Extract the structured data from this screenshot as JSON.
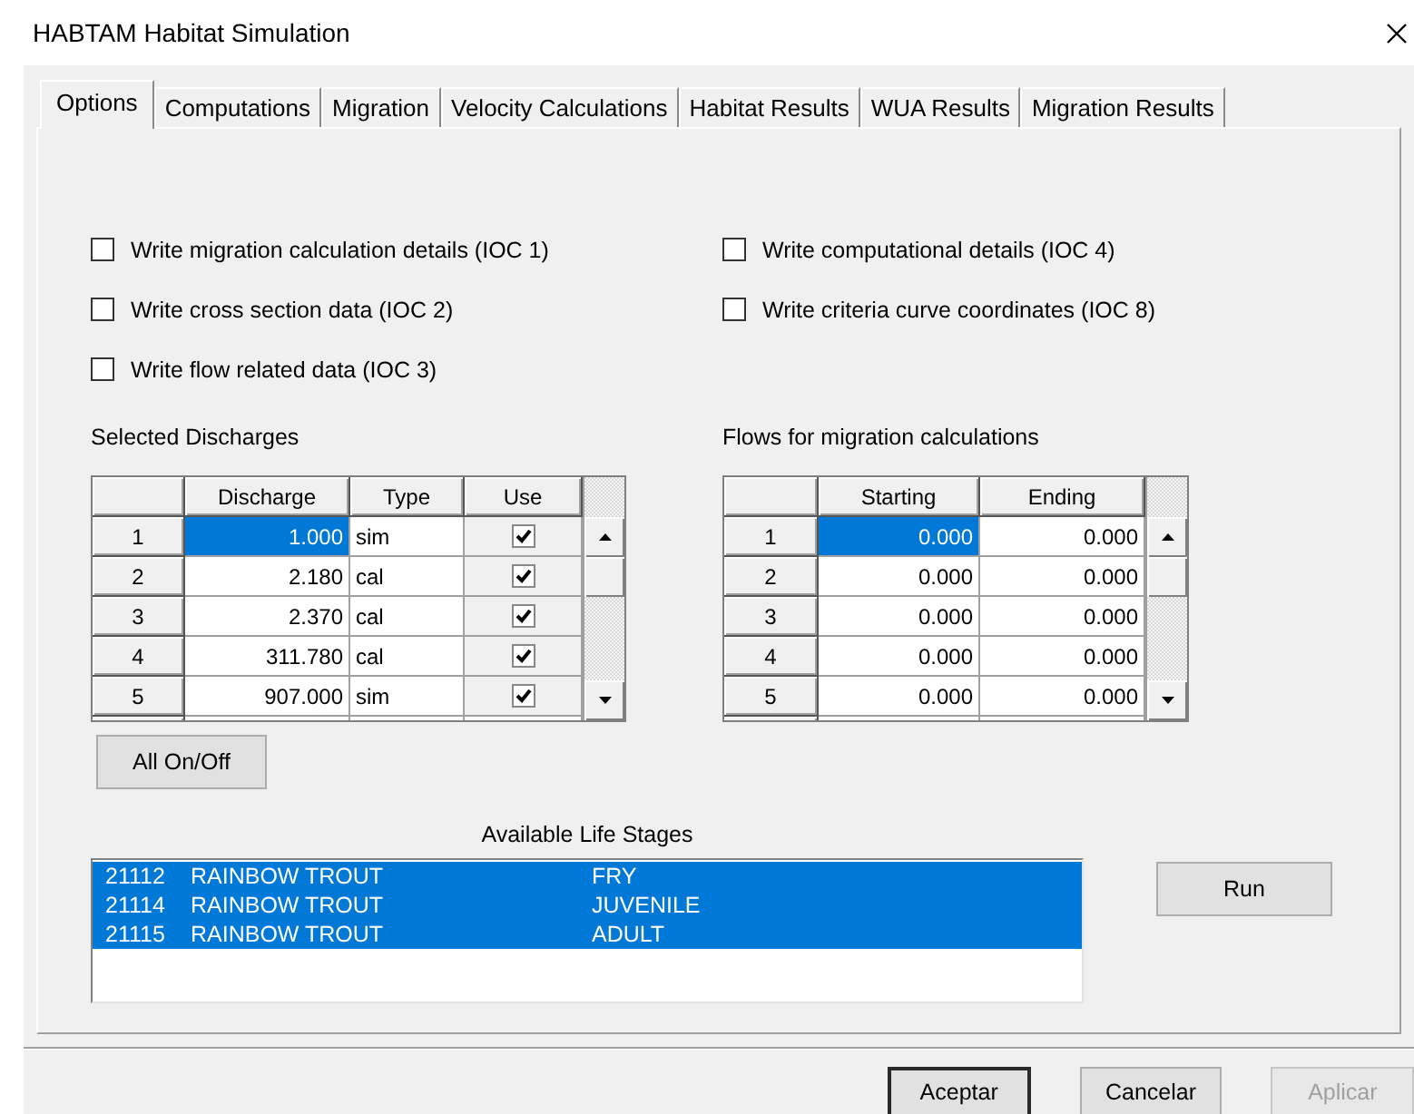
{
  "window": {
    "title": "HABTAM Habitat Simulation"
  },
  "tabs": [
    {
      "label": "Options",
      "selected": true
    },
    {
      "label": "Computations",
      "selected": false
    },
    {
      "label": "Migration",
      "selected": false
    },
    {
      "label": "Velocity Calculations",
      "selected": false
    },
    {
      "label": "Habitat Results",
      "selected": false
    },
    {
      "label": "WUA Results",
      "selected": false
    },
    {
      "label": "Migration Results",
      "selected": false
    }
  ],
  "options": {
    "column_1": [
      {
        "label": "Write migration calculation details (IOC 1)",
        "checked": false
      },
      {
        "label": "Write cross section data (IOC 2)",
        "checked": false
      },
      {
        "label": "Write flow related data (IOC 3)",
        "checked": false
      }
    ],
    "column_2": [
      {
        "label": "Write computational details (IOC 4)",
        "checked": false
      },
      {
        "label": "Write criteria curve coordinates (IOC 8)",
        "checked": false
      }
    ]
  },
  "selected_discharges": {
    "label": "Selected Discharges",
    "columns": [
      {
        "label": "Discharge",
        "kind": "number"
      },
      {
        "label": "Type",
        "kind": "text"
      },
      {
        "label": "Use",
        "kind": "check"
      }
    ],
    "rows": [
      {
        "number": "1",
        "selected": true,
        "cells": [
          {
            "text": "1.000"
          },
          {
            "text": "sim"
          },
          {
            "checked": true
          }
        ]
      },
      {
        "number": "2",
        "selected": false,
        "cells": [
          {
            "text": "2.180"
          },
          {
            "text": "cal"
          },
          {
            "checked": true
          }
        ]
      },
      {
        "number": "3",
        "selected": false,
        "cells": [
          {
            "text": "2.370"
          },
          {
            "text": "cal"
          },
          {
            "checked": true
          }
        ]
      },
      {
        "number": "4",
        "selected": false,
        "cells": [
          {
            "text": "311.780"
          },
          {
            "text": "cal"
          },
          {
            "checked": true
          }
        ]
      },
      {
        "number": "5",
        "selected": false,
        "cells": [
          {
            "text": "907.000"
          },
          {
            "text": "sim"
          },
          {
            "checked": true
          }
        ]
      }
    ]
  },
  "migration_flows": {
    "label": "Flows for migration calculations",
    "columns": [
      {
        "label": "Starting",
        "kind": "number"
      },
      {
        "label": "Ending",
        "kind": "number"
      }
    ],
    "rows": [
      {
        "number": "1",
        "selected": true,
        "cells": [
          {
            "text": "0.000"
          },
          {
            "text": "0.000"
          }
        ]
      },
      {
        "number": "2",
        "selected": false,
        "cells": [
          {
            "text": "0.000"
          },
          {
            "text": "0.000"
          }
        ]
      },
      {
        "number": "3",
        "selected": false,
        "cells": [
          {
            "text": "0.000"
          },
          {
            "text": "0.000"
          }
        ]
      },
      {
        "number": "4",
        "selected": false,
        "cells": [
          {
            "text": "0.000"
          },
          {
            "text": "0.000"
          }
        ]
      },
      {
        "number": "5",
        "selected": false,
        "cells": [
          {
            "text": "0.000"
          },
          {
            "text": "0.000"
          }
        ]
      }
    ]
  },
  "all_toggle_button": "All On/Off",
  "life_stages": {
    "label": "Available Life Stages",
    "items": [
      {
        "code": "21112",
        "species": "RAINBOW TROUT",
        "stage": "FRY",
        "selected": true
      },
      {
        "code": "21114",
        "species": "RAINBOW TROUT",
        "stage": "JUVENILE",
        "selected": true
      },
      {
        "code": "21115",
        "species": "RAINBOW TROUT",
        "stage": "ADULT",
        "selected": true
      }
    ]
  },
  "run_button": "Run",
  "buttons": [
    {
      "label": "Aceptar",
      "default": true,
      "disabled": false
    },
    {
      "label": "Cancelar",
      "default": false,
      "disabled": false
    },
    {
      "label": "Aplicar",
      "default": false,
      "disabled": true
    }
  ]
}
